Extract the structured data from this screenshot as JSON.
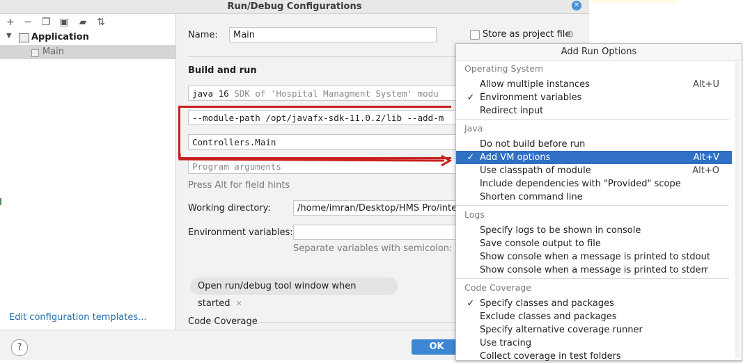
{
  "dialog": {
    "title": "Run/Debug Configurations",
    "name_label": "Name:",
    "name_value": "Main",
    "store_label": "Store as project file",
    "section_title": "Build and run",
    "sdk_field": {
      "main": "java 16",
      "secondary": "SDK of 'Hospital Managment System' modu"
    },
    "vm_options_value": "--module-path /opt/javafx-sdk-11.0.2/lib --add-m",
    "main_class_value": "Controllers.Main",
    "program_args_placeholder": "Program arguments",
    "field_hint": "Press Alt for field hints",
    "working_dir_label": "Working directory:",
    "working_dir_value": "/home/imran/Desktop/HMS Pro/intell",
    "env_label": "Environment variables:",
    "env_hint": "Separate variables with semicolon: VAR",
    "chip_label": "Open run/debug tool window when started",
    "code_coverage_label": "Code Coverage",
    "ok_label": "OK",
    "help_label": "?"
  },
  "left_panel": {
    "toolbar_icons": [
      "add-icon",
      "remove-icon",
      "copy-icon",
      "save-icon",
      "folder-icon",
      "sort-icon"
    ],
    "tree": {
      "group": "Application",
      "child": "Main"
    },
    "edit_templates_link": "Edit configuration templates..."
  },
  "popup": {
    "title": "Add Run Options",
    "groups": [
      {
        "label": "Operating System",
        "items": [
          {
            "text": "Allow multiple instances",
            "shortcut": "Alt+U",
            "checked": false
          },
          {
            "text": "Environment variables",
            "shortcut": "",
            "checked": true
          },
          {
            "text": "Redirect input",
            "shortcut": "",
            "checked": false
          }
        ]
      },
      {
        "label": "Java",
        "items": [
          {
            "text": "Do not build before run",
            "shortcut": "",
            "checked": false
          },
          {
            "text": "Add VM options",
            "shortcut": "Alt+V",
            "checked": true,
            "selected": true
          },
          {
            "text": "Use classpath of module",
            "shortcut": "Alt+O",
            "checked": false
          },
          {
            "text": "Include dependencies with \"Provided\" scope",
            "shortcut": "",
            "checked": false
          },
          {
            "text": "Shorten command line",
            "shortcut": "",
            "checked": false
          }
        ]
      },
      {
        "label": "Logs",
        "items": [
          {
            "text": "Specify logs to be shown in console",
            "shortcut": "",
            "checked": false
          },
          {
            "text": "Save console output to file",
            "shortcut": "",
            "checked": false
          },
          {
            "text": "Show console when a message is printed to stdout",
            "shortcut": "",
            "checked": false
          },
          {
            "text": "Show console when a message is printed to stderr",
            "shortcut": "",
            "checked": false
          }
        ]
      },
      {
        "label": "Code Coverage",
        "items": [
          {
            "text": "Specify classes and packages",
            "shortcut": "",
            "checked": true
          },
          {
            "text": "Exclude classes and packages",
            "shortcut": "",
            "checked": false
          },
          {
            "text": "Specify alternative coverage runner",
            "shortcut": "",
            "checked": false
          },
          {
            "text": "Use tracing",
            "shortcut": "",
            "checked": false
          },
          {
            "text": "Collect coverage in test folders",
            "shortcut": "",
            "checked": false
          }
        ]
      }
    ]
  },
  "colors": {
    "selection": "#2f6fc4",
    "annotation": "#c81e1e",
    "link": "#2470b3",
    "ok_button": "#3c86d4"
  }
}
